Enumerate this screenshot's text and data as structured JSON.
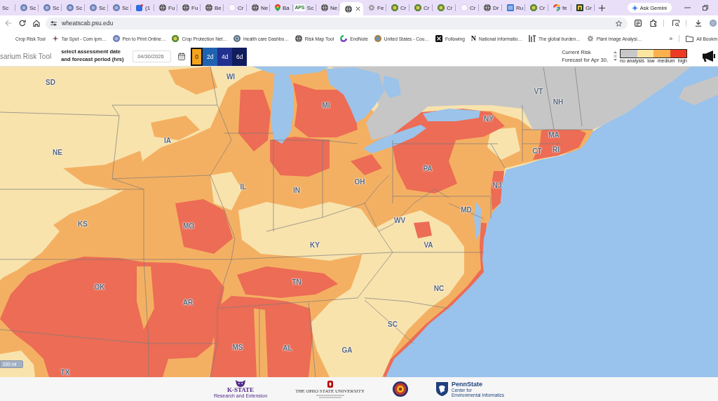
{
  "browser": {
    "tabs": [
      {
        "label": "Sc",
        "kind": "none",
        "selected": false
      },
      {
        "label": "Sc",
        "kind": "disc",
        "selected": false
      },
      {
        "label": "Sc",
        "kind": "disc",
        "selected": false
      },
      {
        "label": "Sc",
        "kind": "disc",
        "selected": false
      },
      {
        "label": "Sc",
        "kind": "disc",
        "selected": false
      },
      {
        "label": "Sc",
        "kind": "disc",
        "selected": false
      },
      {
        "label": "(1",
        "kind": "app",
        "selected": false
      },
      {
        "label": "Fu",
        "kind": "globe",
        "selected": false
      },
      {
        "label": "Fu",
        "kind": "globe",
        "selected": false
      },
      {
        "label": "Be",
        "kind": "globe",
        "selected": false
      },
      {
        "label": "Cr",
        "kind": "blank",
        "selected": false
      },
      {
        "label": "Ne",
        "kind": "globe",
        "selected": false
      },
      {
        "label": "Ba",
        "kind": "pin",
        "selected": false
      },
      {
        "label": "Sc",
        "kind": "badge",
        "badge": "APS",
        "selected": false
      },
      {
        "label": "Ne",
        "kind": "globe",
        "selected": false
      },
      {
        "kind": "globe",
        "selected": true
      },
      {
        "label": "Fe",
        "kind": "gear",
        "selected": false
      },
      {
        "label": "Cr",
        "kind": "seal",
        "selected": false
      },
      {
        "label": "Cr",
        "kind": "seal",
        "selected": false
      },
      {
        "label": "Cr",
        "kind": "seal",
        "selected": false
      },
      {
        "label": "Cr",
        "kind": "blank",
        "selected": false
      },
      {
        "label": "Dr",
        "kind": "globe",
        "selected": false
      },
      {
        "label": "Ru",
        "kind": "stripes",
        "selected": false
      },
      {
        "label": "Cr",
        "kind": "seal",
        "selected": false
      },
      {
        "label": "fe",
        "kind": "g",
        "selected": false
      },
      {
        "label": "Gr",
        "kind": "tile",
        "selected": false
      }
    ],
    "assistant_button": "Ask Gemini",
    "nav": {
      "back_disabled": true
    },
    "url": "wheatscab.psu.edu",
    "bookmarks": [
      {
        "label": "Crop Risk Tool",
        "kind": "none"
      },
      {
        "label": "Tar Spot - Corn ipm…",
        "kind": "star"
      },
      {
        "label": "Pen to Print Online…",
        "kind": "disc"
      },
      {
        "label": "Crop Protection Net…",
        "kind": "seal"
      },
      {
        "label": "Health care Dashbo…",
        "kind": "dial"
      },
      {
        "label": "Risk Map Tool",
        "kind": "globe"
      },
      {
        "label": "EndNote",
        "kind": "ring"
      },
      {
        "label": "United States - Cou…",
        "kind": "emblem"
      },
      {
        "label": "Following",
        "kind": "xtile"
      },
      {
        "label": "National Informatio…",
        "kind": "badge",
        "badge": "N"
      },
      {
        "label": "The global burden…",
        "kind": "glyph"
      },
      {
        "label": "Plant Image Analysi…",
        "kind": "gear"
      }
    ],
    "more_bookmarks": "»",
    "all_bookmarks": "All Bookm"
  },
  "tool": {
    "title": "sarium Risk Tool",
    "period_label": "select assessment date and forecast period (hrs)",
    "date": "04/30/2026",
    "periods": [
      {
        "label": "0",
        "selected": true,
        "color": "#f7a41d"
      },
      {
        "label": "2d",
        "selected": false,
        "color": "#1f62b0"
      },
      {
        "label": "4d",
        "selected": false,
        "color": "#22318f"
      },
      {
        "label": "6d",
        "selected": false,
        "color": "#101c5c"
      }
    ],
    "risk_title": "Current Risk",
    "risk_subtitle": "Forecast for Apr 30,",
    "legend": [
      {
        "label": "no analysis",
        "color": "#c8c8c8"
      },
      {
        "label": "low",
        "color": "#fbe6a0"
      },
      {
        "label": "medium",
        "color": "#fbb04c"
      },
      {
        "label": "high",
        "color": "#ec3b23"
      }
    ]
  },
  "map": {
    "state_labels": [
      "SD",
      "WI",
      "MI",
      "NE",
      "IA",
      "IL",
      "IN",
      "OH",
      "NY",
      "VT",
      "NH",
      "MA",
      "CT",
      "RI",
      "PA",
      "NJ",
      "KS",
      "MO",
      "WV",
      "MD",
      "KY",
      "VA",
      "OK",
      "AR",
      "TN",
      "NC",
      "SC",
      "MS",
      "AL",
      "GA",
      "TX"
    ],
    "scale": "100 mi"
  },
  "footer": {
    "partners": [
      {
        "kind": "kstate",
        "name": "K-STATE",
        "subtitle": "Research and Extension"
      },
      {
        "kind": "ohio",
        "name": "THE OHIO STATE UNIVERSITY"
      },
      {
        "kind": "seal"
      },
      {
        "kind": "pennstate",
        "name": "PennState",
        "lines": [
          "Center for",
          "Environmental Informatics"
        ]
      }
    ]
  }
}
